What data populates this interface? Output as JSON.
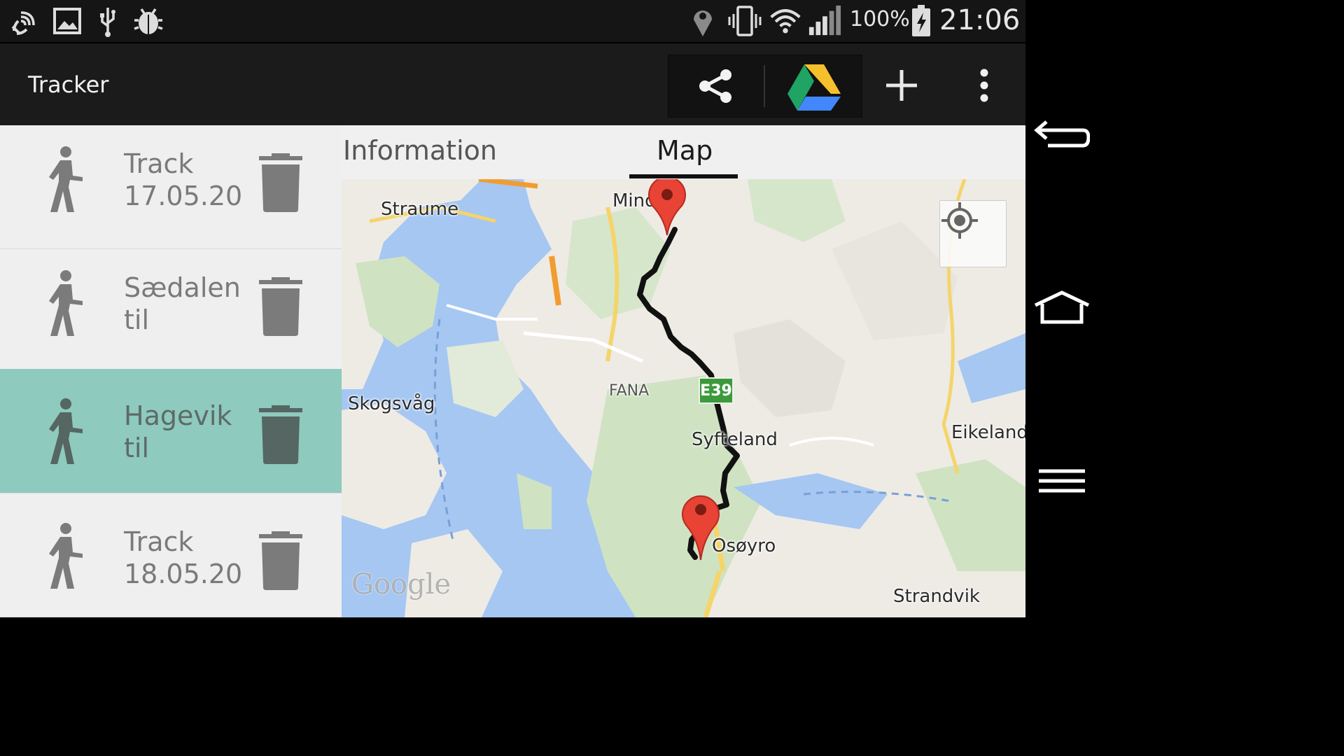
{
  "status_bar": {
    "icons": [
      "nfc-icon",
      "image-icon",
      "usb-icon",
      "bug-icon",
      "location-icon",
      "vibrate-icon",
      "wifi-icon",
      "signal-icon",
      "battery-icon"
    ],
    "battery": "100%",
    "time": "21:06"
  },
  "action_bar": {
    "title": "Tracker",
    "actions": [
      "share-icon",
      "google-drive-icon",
      "add-icon",
      "overflow-menu-icon"
    ]
  },
  "tracks": [
    {
      "name": "Track\n17.05.20",
      "selected": false
    },
    {
      "name": "Sædalen\ntil",
      "selected": false
    },
    {
      "name": "Hagevik\ntil",
      "selected": true
    },
    {
      "name": "Track\n18.05.20",
      "selected": false
    }
  ],
  "tabs": [
    {
      "label": "Information",
      "active": false
    },
    {
      "label": "Map",
      "active": true
    }
  ],
  "map": {
    "labels": {
      "straume": "Straume",
      "mind": "Mind",
      "skogsvag": "Skogsvåg",
      "fana": "FANA",
      "syfteland": "Syfteland",
      "osoyro": "Osøyro",
      "eikelands": "Eikelands",
      "strandvik": "Strandvik"
    },
    "road_shield": "E39",
    "attribution": "Google"
  },
  "nav_bar": {
    "buttons": [
      "back-icon",
      "home-icon",
      "menu-icon"
    ]
  },
  "colors": {
    "selected_row": "#8ecabd",
    "water": "#a5c7f2",
    "land": "#eeebe5",
    "park": "#cfe3c2",
    "marker": "#e84335"
  }
}
